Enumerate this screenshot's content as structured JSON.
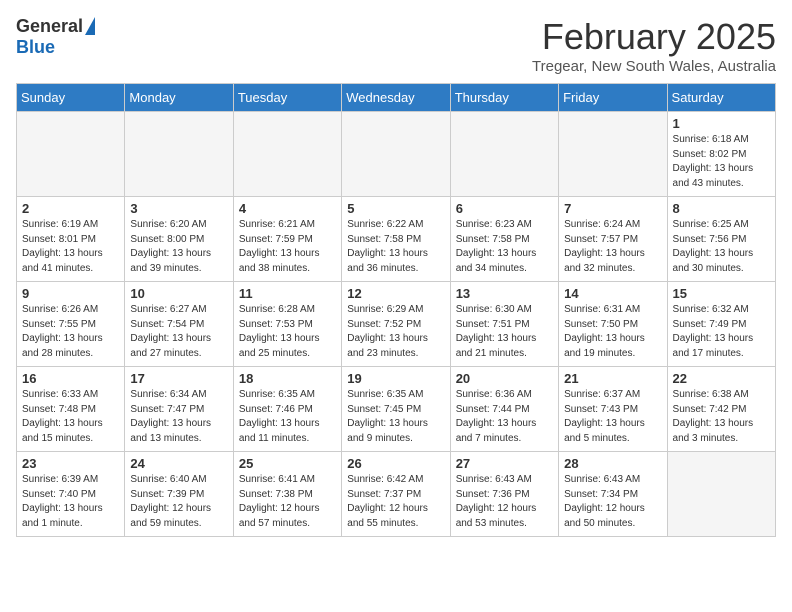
{
  "logo": {
    "general": "General",
    "blue": "Blue"
  },
  "title": {
    "month": "February 2025",
    "location": "Tregear, New South Wales, Australia"
  },
  "calendar": {
    "weekdays": [
      "Sunday",
      "Monday",
      "Tuesday",
      "Wednesday",
      "Thursday",
      "Friday",
      "Saturday"
    ],
    "weeks": [
      [
        {
          "day": "",
          "empty": true
        },
        {
          "day": "",
          "empty": true
        },
        {
          "day": "",
          "empty": true
        },
        {
          "day": "",
          "empty": true
        },
        {
          "day": "",
          "empty": true
        },
        {
          "day": "",
          "empty": true
        },
        {
          "day": "1",
          "sunrise": "6:18 AM",
          "sunset": "8:02 PM",
          "daylight": "13 hours and 43 minutes."
        }
      ],
      [
        {
          "day": "2",
          "sunrise": "6:19 AM",
          "sunset": "8:01 PM",
          "daylight": "13 hours and 41 minutes."
        },
        {
          "day": "3",
          "sunrise": "6:20 AM",
          "sunset": "8:00 PM",
          "daylight": "13 hours and 39 minutes."
        },
        {
          "day": "4",
          "sunrise": "6:21 AM",
          "sunset": "7:59 PM",
          "daylight": "13 hours and 38 minutes."
        },
        {
          "day": "5",
          "sunrise": "6:22 AM",
          "sunset": "7:58 PM",
          "daylight": "13 hours and 36 minutes."
        },
        {
          "day": "6",
          "sunrise": "6:23 AM",
          "sunset": "7:58 PM",
          "daylight": "13 hours and 34 minutes."
        },
        {
          "day": "7",
          "sunrise": "6:24 AM",
          "sunset": "7:57 PM",
          "daylight": "13 hours and 32 minutes."
        },
        {
          "day": "8",
          "sunrise": "6:25 AM",
          "sunset": "7:56 PM",
          "daylight": "13 hours and 30 minutes."
        }
      ],
      [
        {
          "day": "9",
          "sunrise": "6:26 AM",
          "sunset": "7:55 PM",
          "daylight": "13 hours and 28 minutes."
        },
        {
          "day": "10",
          "sunrise": "6:27 AM",
          "sunset": "7:54 PM",
          "daylight": "13 hours and 27 minutes."
        },
        {
          "day": "11",
          "sunrise": "6:28 AM",
          "sunset": "7:53 PM",
          "daylight": "13 hours and 25 minutes."
        },
        {
          "day": "12",
          "sunrise": "6:29 AM",
          "sunset": "7:52 PM",
          "daylight": "13 hours and 23 minutes."
        },
        {
          "day": "13",
          "sunrise": "6:30 AM",
          "sunset": "7:51 PM",
          "daylight": "13 hours and 21 minutes."
        },
        {
          "day": "14",
          "sunrise": "6:31 AM",
          "sunset": "7:50 PM",
          "daylight": "13 hours and 19 minutes."
        },
        {
          "day": "15",
          "sunrise": "6:32 AM",
          "sunset": "7:49 PM",
          "daylight": "13 hours and 17 minutes."
        }
      ],
      [
        {
          "day": "16",
          "sunrise": "6:33 AM",
          "sunset": "7:48 PM",
          "daylight": "13 hours and 15 minutes."
        },
        {
          "day": "17",
          "sunrise": "6:34 AM",
          "sunset": "7:47 PM",
          "daylight": "13 hours and 13 minutes."
        },
        {
          "day": "18",
          "sunrise": "6:35 AM",
          "sunset": "7:46 PM",
          "daylight": "13 hours and 11 minutes."
        },
        {
          "day": "19",
          "sunrise": "6:35 AM",
          "sunset": "7:45 PM",
          "daylight": "13 hours and 9 minutes."
        },
        {
          "day": "20",
          "sunrise": "6:36 AM",
          "sunset": "7:44 PM",
          "daylight": "13 hours and 7 minutes."
        },
        {
          "day": "21",
          "sunrise": "6:37 AM",
          "sunset": "7:43 PM",
          "daylight": "13 hours and 5 minutes."
        },
        {
          "day": "22",
          "sunrise": "6:38 AM",
          "sunset": "7:42 PM",
          "daylight": "13 hours and 3 minutes."
        }
      ],
      [
        {
          "day": "23",
          "sunrise": "6:39 AM",
          "sunset": "7:40 PM",
          "daylight": "13 hours and 1 minute."
        },
        {
          "day": "24",
          "sunrise": "6:40 AM",
          "sunset": "7:39 PM",
          "daylight": "12 hours and 59 minutes."
        },
        {
          "day": "25",
          "sunrise": "6:41 AM",
          "sunset": "7:38 PM",
          "daylight": "12 hours and 57 minutes."
        },
        {
          "day": "26",
          "sunrise": "6:42 AM",
          "sunset": "7:37 PM",
          "daylight": "12 hours and 55 minutes."
        },
        {
          "day": "27",
          "sunrise": "6:43 AM",
          "sunset": "7:36 PM",
          "daylight": "12 hours and 53 minutes."
        },
        {
          "day": "28",
          "sunrise": "6:43 AM",
          "sunset": "7:34 PM",
          "daylight": "12 hours and 50 minutes."
        },
        {
          "day": "",
          "empty": true
        }
      ]
    ]
  }
}
